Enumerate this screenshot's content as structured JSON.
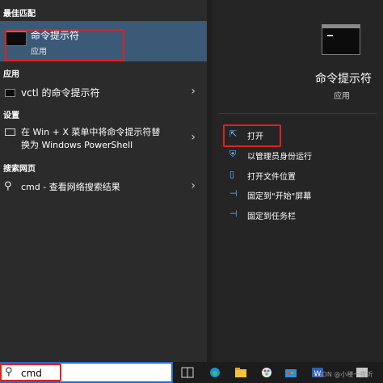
{
  "left": {
    "best_match_header": "最佳匹配",
    "best_match": {
      "title": "命令提示符",
      "subtitle": "应用"
    },
    "apps_header": "应用",
    "apps_items": [
      {
        "label": "vctl 的命令提示符"
      }
    ],
    "settings_header": "设置",
    "settings_items": [
      {
        "line1": "在 Win + X 菜单中将命令提示符替",
        "line2": "换为 Windows PowerShell"
      }
    ],
    "web_header": "搜索网页",
    "web_items": [
      {
        "label": "cmd - 查看网络搜索结果"
      }
    ],
    "chevron": "›"
  },
  "right": {
    "app_name": "命令提示符",
    "app_type": "应用",
    "actions": [
      {
        "icon": "open-icon",
        "label": "打开"
      },
      {
        "icon": "run-as-admin-icon",
        "label": "以管理员身份运行"
      },
      {
        "icon": "open-file-location-icon",
        "label": "打开文件位置"
      },
      {
        "icon": "pin-to-start-icon",
        "label": "固定到\"开始\"屏幕"
      },
      {
        "icon": "pin-to-taskbar-icon",
        "label": "固定到任务栏"
      }
    ]
  },
  "taskbar": {
    "search_value": "cmd",
    "icons": [
      "task-view-icon",
      "edge-icon",
      "file-explorer-icon",
      "paint-icon",
      "store-icon",
      "word-icon",
      "app-icon"
    ]
  },
  "watermark": "CSDN @小楼一夜听"
}
